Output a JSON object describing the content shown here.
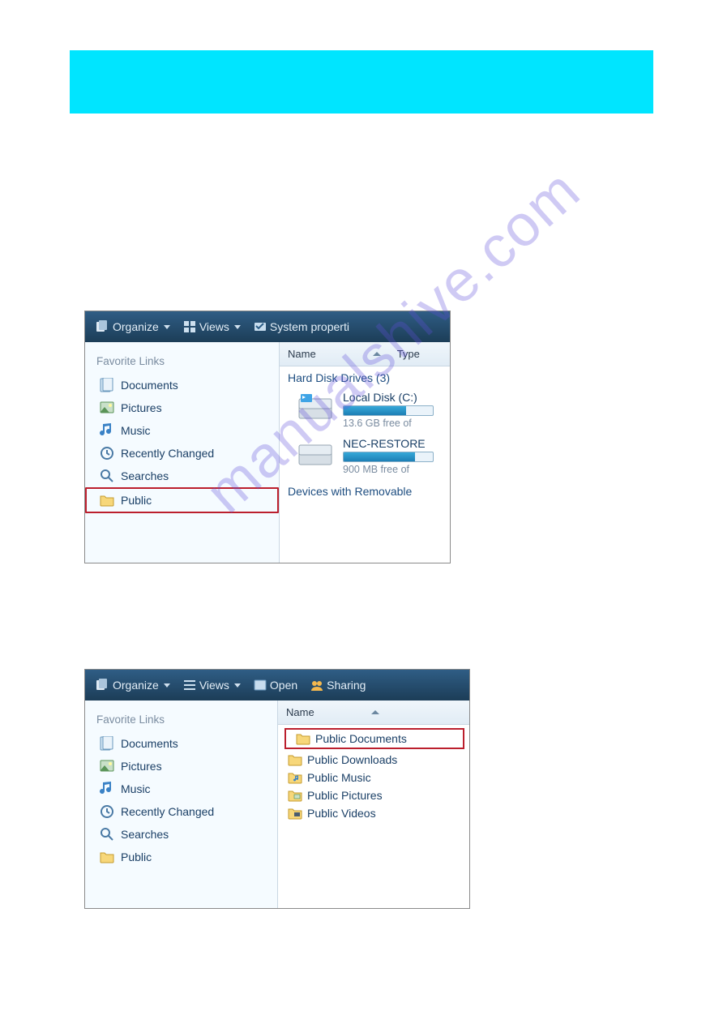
{
  "watermark": "manualshive.com",
  "screenshot1": {
    "toolbar": {
      "organize": "Organize",
      "views": "Views",
      "system_properties": "System properti"
    },
    "nav": {
      "header": "Favorite Links",
      "links": {
        "documents": "Documents",
        "pictures": "Pictures",
        "music": "Music",
        "recently_changed": "Recently Changed",
        "searches": "Searches",
        "public": "Public"
      }
    },
    "columns": {
      "name": "Name",
      "type": "Type"
    },
    "group": "Hard Disk Drives (3)",
    "drive1": {
      "label": "Local Disk (C:)",
      "free": "13.6 GB free of",
      "fill_pct": 70
    },
    "drive2": {
      "label": "NEC-RESTORE",
      "free": "900 MB free of",
      "fill_pct": 80
    },
    "group2": "Devices with Removable"
  },
  "screenshot2": {
    "toolbar": {
      "organize": "Organize",
      "views": "Views",
      "open": "Open",
      "sharing": "Sharing"
    },
    "nav": {
      "header": "Favorite Links",
      "links": {
        "documents": "Documents",
        "pictures": "Pictures",
        "music": "Music",
        "recently_changed": "Recently Changed",
        "searches": "Searches",
        "public": "Public"
      }
    },
    "columns": {
      "name": "Name"
    },
    "folders": {
      "pub_docs": "Public Documents",
      "pub_downloads": "Public Downloads",
      "pub_music": "Public Music",
      "pub_pictures": "Public Pictures",
      "pub_videos": "Public Videos"
    }
  }
}
